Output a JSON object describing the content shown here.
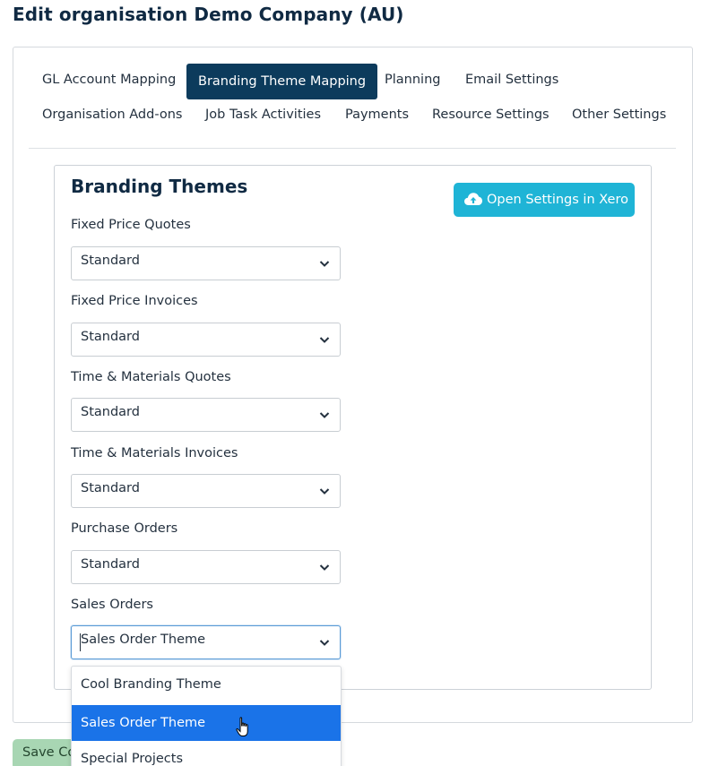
{
  "page": {
    "title": "Edit organisation Demo Company (AU)"
  },
  "tabs": [
    {
      "label": "GL Account Mapping"
    },
    {
      "label": "Branding Theme Mapping"
    },
    {
      "label": "Planning"
    },
    {
      "label": "Email Settings"
    },
    {
      "label": "Organisation Add-ons"
    },
    {
      "label": "Job Task Activities"
    },
    {
      "label": "Payments"
    },
    {
      "label": "Resource Settings"
    },
    {
      "label": "Other Settings"
    }
  ],
  "active_tab": "Branding Theme Mapping",
  "section": {
    "title": "Branding Themes",
    "xero_button": {
      "label": "Open Settings in Xero",
      "icon": "cloud-upload-icon",
      "color": "#1fb4d6"
    }
  },
  "fields": [
    {
      "label": "Fixed Price Quotes",
      "value": "Standard"
    },
    {
      "label": "Fixed Price Invoices",
      "value": "Standard"
    },
    {
      "label": "Time & Materials Quotes",
      "value": "Standard"
    },
    {
      "label": "Time & Materials Invoices",
      "value": "Standard"
    },
    {
      "label": "Purchase Orders",
      "value": "Standard"
    },
    {
      "label": "Sales Orders",
      "value": "Sales Order Theme"
    }
  ],
  "dropdown": {
    "options": [
      {
        "label": "Cool Branding Theme"
      },
      {
        "label": "Sales Order Theme"
      },
      {
        "label": "Special Projects"
      }
    ],
    "highlighted": "Sales Order Theme",
    "highlight_color": "#1a73e8"
  },
  "footer": {
    "save_label": "Save Co"
  },
  "colors": {
    "active_tab": "#0c3b5c",
    "save_button": "#a8d6b3"
  }
}
